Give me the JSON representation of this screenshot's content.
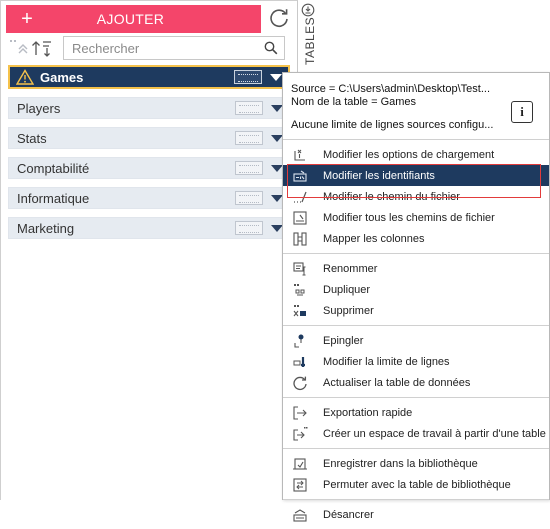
{
  "toolbar": {
    "add_label": "AJOUTER",
    "add_icon": "plus-icon",
    "refresh_icon": "refresh-icon",
    "search_placeholder": "Rechercher",
    "search_icon": "search-icon",
    "sort_icons": [
      "reorder-icon",
      "sort-icon"
    ]
  },
  "side_tab": {
    "label": "TABLES",
    "pin_icon": "pin-icon"
  },
  "tables": [
    {
      "name": "Games",
      "selected": true,
      "warning": true
    },
    {
      "name": "Players",
      "selected": false
    },
    {
      "name": "Stats",
      "selected": false
    },
    {
      "name": "Comptabilité",
      "selected": false
    },
    {
      "name": "Informatique",
      "selected": false
    },
    {
      "name": "Marketing",
      "selected": false
    }
  ],
  "context_menu": {
    "info": {
      "source": "Source = C:\\Users\\admin\\Desktop\\Test...",
      "table_name": "Nom de la table = Games",
      "limit": "Aucune limite de lignes sources configu...",
      "info_icon": "info-icon",
      "info_glyph": "i"
    },
    "groups": [
      [
        {
          "label": "Modifier les options de chargement",
          "icon": "load-options-icon"
        },
        {
          "label": "Modifier les identifiants",
          "icon": "credentials-icon",
          "active": true
        },
        {
          "label": "Modifier le chemin du fichier",
          "icon": "file-path-icon"
        },
        {
          "label": "Modifier tous les chemins de fichier",
          "icon": "all-paths-icon"
        },
        {
          "label": "Mapper les colonnes",
          "icon": "map-columns-icon"
        }
      ],
      [
        {
          "label": "Renommer",
          "icon": "rename-icon"
        },
        {
          "label": "Dupliquer",
          "icon": "duplicate-icon"
        },
        {
          "label": "Supprimer",
          "icon": "delete-icon"
        }
      ],
      [
        {
          "label": "Epingler",
          "icon": "pin-icon"
        },
        {
          "label": "Modifier la limite de lignes",
          "icon": "row-limit-icon"
        },
        {
          "label": "Actualiser la table de données",
          "icon": "refresh-icon"
        }
      ],
      [
        {
          "label": "Exportation rapide",
          "icon": "export-icon"
        },
        {
          "label": "Créer un espace de travail à partir d'une table",
          "icon": "workspace-icon"
        }
      ],
      [
        {
          "label": "Enregistrer dans la bibliothèque",
          "icon": "save-library-icon"
        },
        {
          "label": "Permuter avec la table de bibliothèque",
          "icon": "swap-library-icon"
        }
      ],
      [
        {
          "label": "Désancrer",
          "icon": "undock-icon"
        }
      ]
    ]
  },
  "colors": {
    "accent_pink": "#f4456a",
    "selected_navy": "#1e3a5f",
    "selected_border": "#f5c24b",
    "highlight_red": "#e23b3b",
    "item_bg": "#e6ebf1"
  }
}
